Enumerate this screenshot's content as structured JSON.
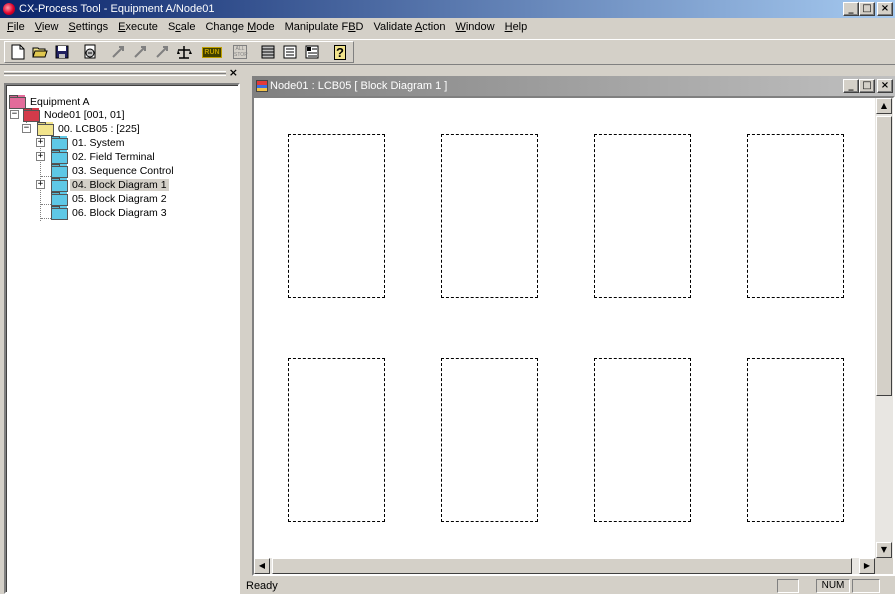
{
  "titlebar": {
    "title": "CX-Process Tool - Equipment A/Node01",
    "buttons": {
      "minimize": "_",
      "maximize": "□",
      "close": "×"
    }
  },
  "menubar": {
    "items": [
      {
        "pre": "",
        "key": "F",
        "post": "ile"
      },
      {
        "pre": "",
        "key": "V",
        "post": "iew"
      },
      {
        "pre": "",
        "key": "S",
        "post": "ettings"
      },
      {
        "pre": "",
        "key": "E",
        "post": "xecute"
      },
      {
        "pre": "S",
        "key": "c",
        "post": "ale"
      },
      {
        "pre": "Change ",
        "key": "M",
        "post": "ode"
      },
      {
        "pre": "Manipulate F",
        "key": "B",
        "post": "D"
      },
      {
        "pre": "Validate ",
        "key": "A",
        "post": "ction"
      },
      {
        "pre": "",
        "key": "W",
        "post": "indow"
      },
      {
        "pre": "",
        "key": "H",
        "post": "elp"
      }
    ]
  },
  "toolbar": {
    "icons": [
      "new-file-icon",
      "open-folder-icon",
      "save-icon",
      "properties-icon",
      "transfer-up-icon",
      "transfer-right-icon",
      "transfer-down-icon",
      "validate-icon",
      "run-icon",
      "all-stop-icon",
      "block-view-icon",
      "block-list-icon",
      "tag-icon",
      "help-icon"
    ],
    "run_glyph": "RUN",
    "stop_glyph": "ALL STOP",
    "help_glyph": "?"
  },
  "left_pane": {
    "close_glyph": "×",
    "tree": [
      {
        "label": "Equipment A",
        "folder": "pink"
      },
      {
        "label": "Node01 [001, 01]",
        "folder": "red",
        "expander": "−"
      },
      {
        "label": "00. LCB05 : [225]",
        "folder": "yellow",
        "expander": "−"
      },
      {
        "label": "01. System",
        "folder": "cyan",
        "expander": "+"
      },
      {
        "label": "02. Field Terminal",
        "folder": "cyan",
        "expander": "+"
      },
      {
        "label": "03. Sequence Control",
        "folder": "cyan"
      },
      {
        "label": "04. Block Diagram 1",
        "folder": "cyan",
        "expander": "+",
        "selected": true
      },
      {
        "label": "05. Block Diagram 2",
        "folder": "cyan"
      },
      {
        "label": "06. Block Diagram 3",
        "folder": "cyan"
      }
    ]
  },
  "child_window": {
    "title": "Node01 : LCB05  [ Block Diagram 1 ]",
    "buttons": {
      "minimize": "_",
      "maximize": "□",
      "close": "×"
    },
    "block_count": 8,
    "scroll": {
      "up": "▲",
      "down": "▼",
      "left": "◀",
      "right": "▶"
    }
  },
  "statusbar": {
    "text": "Ready",
    "num": "NUM"
  }
}
